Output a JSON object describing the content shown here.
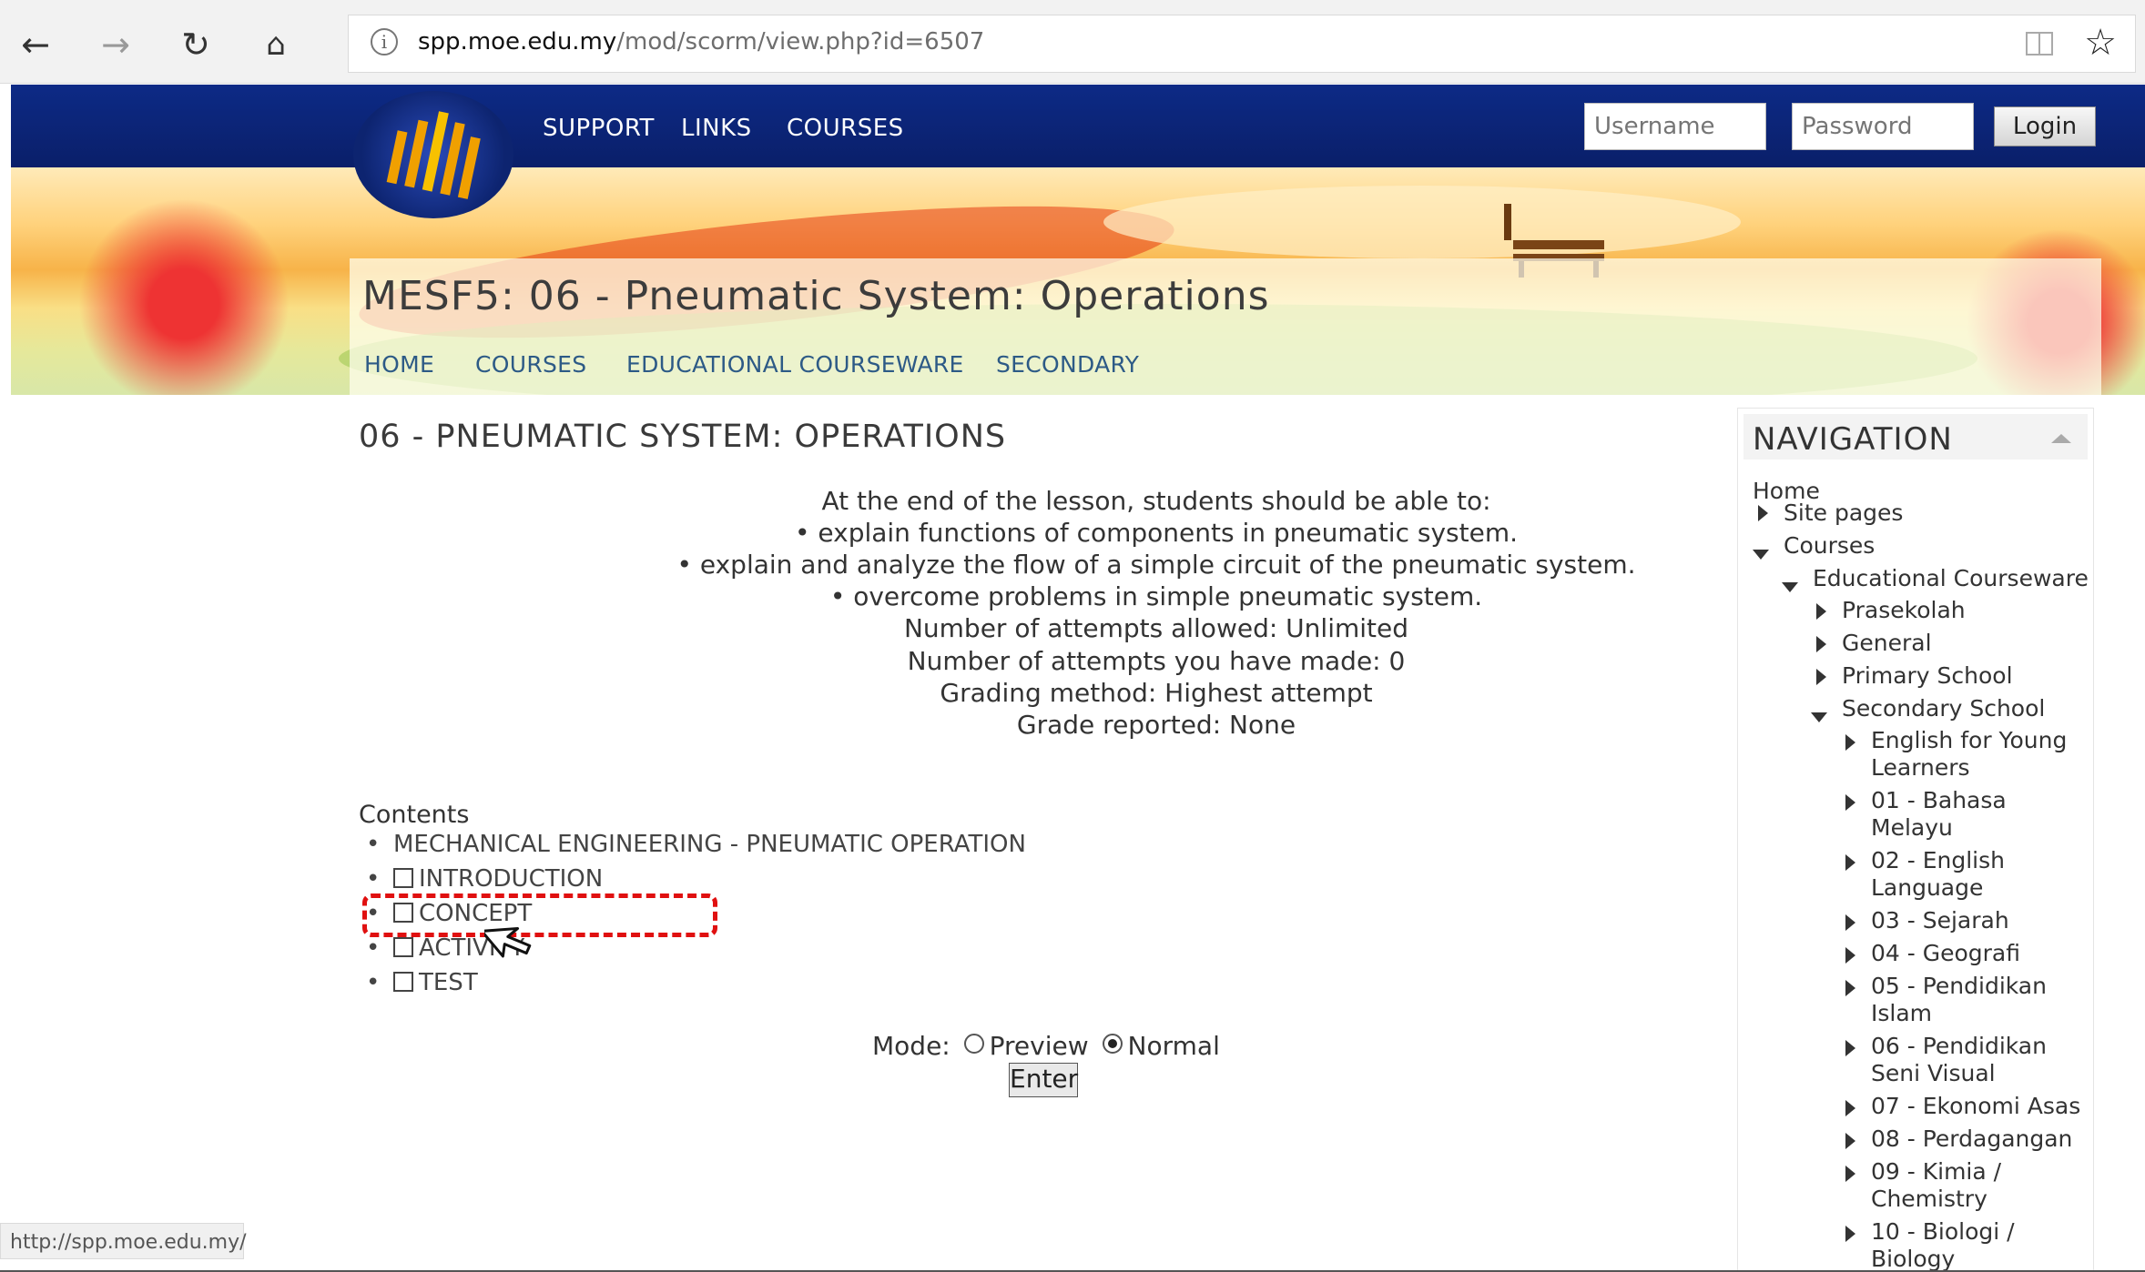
{
  "browser": {
    "url_host": "spp.moe.edu.my",
    "url_path": "/mod/scorm/view.php?id=6507",
    "status_url": "http://spp.moe.edu.my/"
  },
  "header": {
    "nav": [
      "SUPPORT",
      "LINKS",
      "COURSES"
    ],
    "username_placeholder": "Username",
    "password_placeholder": "Password",
    "login_label": "Login"
  },
  "course": {
    "title": "MESF5: 06 - Pneumatic System: Operations",
    "breadcrumb": [
      "HOME",
      "COURSES",
      "EDUCATIONAL COURSEWARE",
      "SECONDARY"
    ]
  },
  "main": {
    "heading": "06 - PNEUMATIC SYSTEM: OPERATIONS",
    "intro_lines": [
      "At the end of the lesson, students should be able to:",
      "• explain functions of components in pneumatic system.",
      "• explain and analyze the flow of a simple circuit of the pneumatic system.",
      "• overcome problems in simple pneumatic system.",
      "Number of attempts allowed: Unlimited",
      "Number of attempts you have made: 0",
      "Grading method: Highest attempt",
      "Grade reported: None"
    ],
    "contents_label": "Contents",
    "toc_title": "MECHANICAL ENGINEERING - PNEUMATIC OPERATION",
    "toc_items": [
      "INTRODUCTION",
      "CONCEPT",
      "ACTIVITY",
      "TEST"
    ],
    "mode_label": "Mode:",
    "mode_preview": "Preview",
    "mode_normal": "Normal",
    "enter_label": "Enter"
  },
  "navigation": {
    "title": "NAVIGATION",
    "home": "Home",
    "site_pages": "Site pages",
    "courses": "Courses",
    "educational_courseware": "Educational Courseware",
    "prasekolah": "Prasekolah",
    "general": "General",
    "primary_school": "Primary School",
    "secondary_school": "Secondary School",
    "subjects": [
      {
        "l1": "English for Young",
        "l2": "Learners"
      },
      {
        "l1": "01 - Bahasa",
        "l2": "Melayu"
      },
      {
        "l1": "02 - English",
        "l2": "Language"
      },
      {
        "l1": "03 - Sejarah",
        "l2": ""
      },
      {
        "l1": "04 - Geografi",
        "l2": ""
      },
      {
        "l1": "05 - Pendidikan",
        "l2": "Islam"
      },
      {
        "l1": "06 - Pendidikan",
        "l2": "Seni Visual"
      },
      {
        "l1": "07 - Ekonomi Asas",
        "l2": ""
      },
      {
        "l1": "08 - Perdagangan",
        "l2": ""
      },
      {
        "l1": "09 - Kimia /",
        "l2": "Chemistry"
      },
      {
        "l1": "10 - Biologi /",
        "l2": "Biology"
      }
    ]
  }
}
